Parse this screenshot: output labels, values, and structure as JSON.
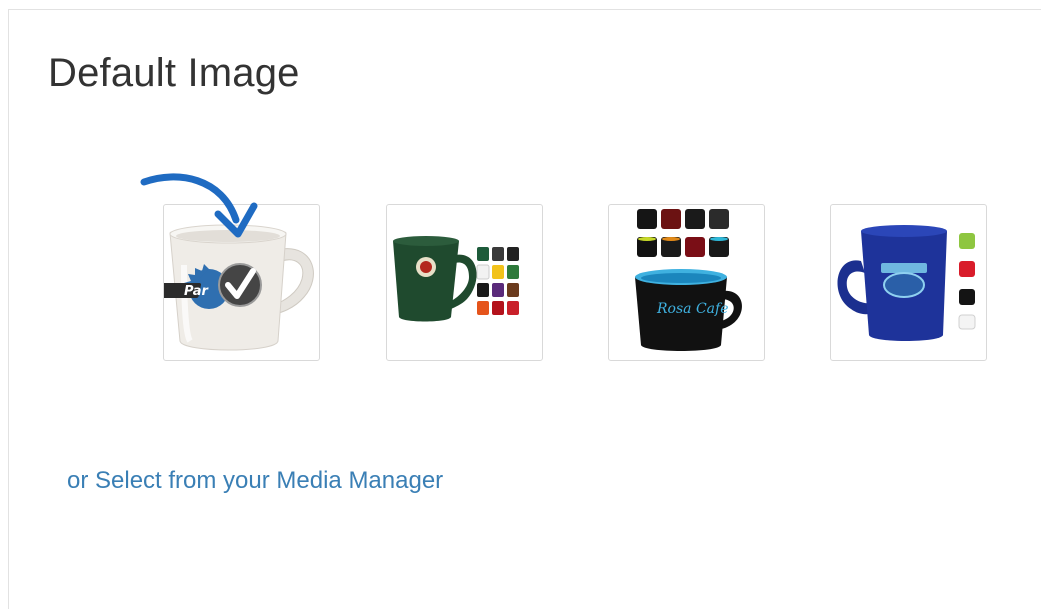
{
  "section": {
    "title": "Default Image"
  },
  "thumbnails": [
    {
      "id": "white-mug",
      "mug_color": "#ece9e4",
      "selected": true
    },
    {
      "id": "green-mug",
      "mug_color": "#1f4a2e",
      "selected": false
    },
    {
      "id": "black-bistro-mug",
      "mug_color": "#111111",
      "selected": false
    },
    {
      "id": "blue-mug",
      "mug_color": "#1b2f8f",
      "selected": false
    }
  ],
  "selection_badge": {
    "icon": "check-icon",
    "color": "#454545"
  },
  "pointer_arrow": {
    "icon": "curved-arrow-icon",
    "color": "#1f6bc2"
  },
  "media_link": {
    "label": "or Select from your Media Manager",
    "color": "#3a7fb5"
  }
}
